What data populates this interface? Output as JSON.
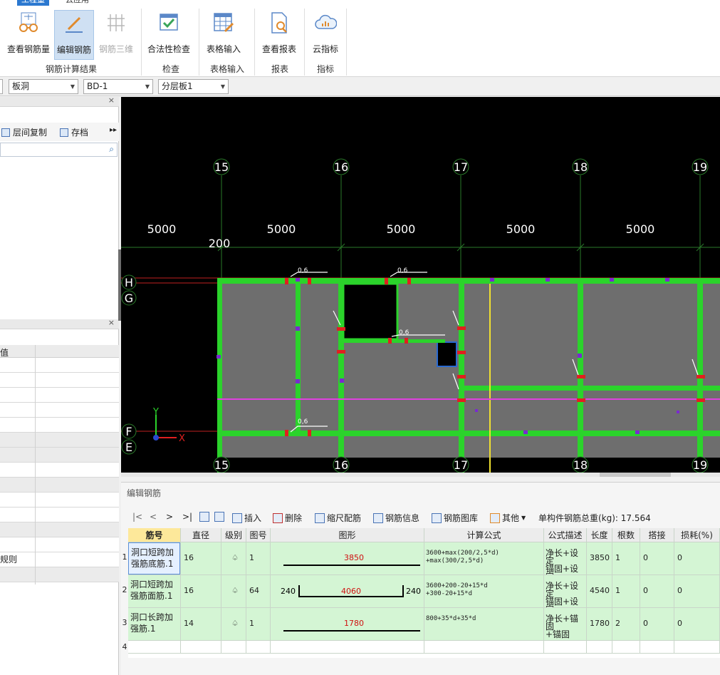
{
  "menu": {
    "tabs": [
      "工程量",
      "云应用"
    ]
  },
  "ribbon": {
    "buttons": [
      {
        "label": "查看钢筋量",
        "icon": "glasses-icon"
      },
      {
        "label": "编辑钢筋",
        "icon": "pencil-icon"
      },
      {
        "label": "钢筋三维",
        "icon": "rebar-3d-icon"
      },
      {
        "label": "合法性检查",
        "icon": "check-icon"
      },
      {
        "label": "表格输入",
        "icon": "table-input-icon"
      },
      {
        "label": "查看报表",
        "icon": "report-search-icon"
      },
      {
        "label": "云指标",
        "icon": "cloud-icon"
      }
    ],
    "groups": [
      "钢筋计算结果",
      "检查",
      "表格输入",
      "报表",
      "指标"
    ]
  },
  "dropdowns": [
    "板洞",
    "BD-1",
    "分层板1"
  ],
  "left_panel": {
    "tools": [
      "层间复制",
      "存档"
    ],
    "prop_header": "值",
    "prop_item": "规则"
  },
  "canvas": {
    "axis_top": [
      "15",
      "16",
      "17",
      "18",
      "19"
    ],
    "dims": [
      "5000",
      "5000",
      "5000",
      "5000",
      "5000"
    ],
    "dim_small": "200",
    "axis_left": [
      "H",
      "G",
      "F",
      "E"
    ],
    "bar_label": "0,6",
    "xy": {
      "x": "X",
      "y": "Y"
    }
  },
  "editor": {
    "title": "编辑钢筋",
    "nav": [
      "|<",
      "<",
      ">",
      ">|"
    ],
    "tools": [
      "插入",
      "删除",
      "缩尺配筋",
      "钢筋信息",
      "钢筋图库",
      "其他"
    ],
    "weight": "单构件钢筋总重(kg): 17.564",
    "columns": [
      "筋号",
      "直径(mm)",
      "级别",
      "图号",
      "图形",
      "计算公式",
      "公式描述",
      "长度",
      "根数",
      "搭接",
      "损耗(%)"
    ],
    "rows": [
      {
        "num": "1",
        "name": "洞口短跨加强筋底筋.1",
        "dia": "16",
        "grade": "♤",
        "fig": "1",
        "shape_main": "3850",
        "shape_left": "",
        "shape_right": "",
        "formula": [
          "3600+max(200/2,5*d)",
          "+max(300/2,5*d)"
        ],
        "desc": [
          "净长+设定",
          "锚固+设定",
          "锚固"
        ],
        "length": "3850",
        "count": "1",
        "lap": "0",
        "loss": "0"
      },
      {
        "num": "2",
        "name": "洞口短跨加强筋面筋.1",
        "dia": "16",
        "grade": "♤",
        "fig": "64",
        "shape_main": "4060",
        "shape_left": "240",
        "shape_right": "240",
        "formula": [
          "3600+200-20+15*d",
          "+300-20+15*d"
        ],
        "desc": [
          "净长+设定",
          "锚固+设定",
          "锚固"
        ],
        "length": "4540",
        "count": "1",
        "lap": "0",
        "loss": "0"
      },
      {
        "num": "3",
        "name": "洞口长跨加强筋.1",
        "dia": "14",
        "grade": "♤",
        "fig": "1",
        "shape_main": "1780",
        "shape_left": "",
        "shape_right": "",
        "formula": [
          "800+35*d+35*d"
        ],
        "desc": [
          "净长+锚固",
          "+锚固"
        ],
        "length": "1780",
        "count": "2",
        "lap": "0",
        "loss": "0"
      },
      {
        "num": "4"
      }
    ]
  }
}
